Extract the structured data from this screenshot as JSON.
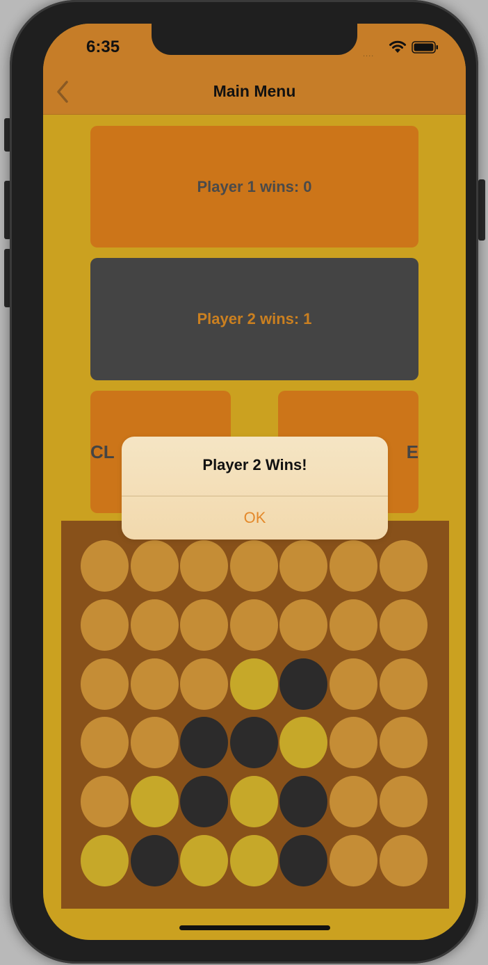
{
  "status_bar": {
    "time": "6:35",
    "signal": "....",
    "wifi_icon": "wifi-icon",
    "battery_icon": "battery-icon"
  },
  "nav": {
    "title": "Main Menu",
    "back_icon": "chevron-left-icon"
  },
  "tiles": {
    "player1": "Player 1 wins: 0",
    "player2": "Player 2 wins: 1",
    "left_fragment": "CL",
    "right_fragment": "E"
  },
  "board": {
    "colors": {
      "empty": "#c58d36",
      "yellow": "#c6a829",
      "black": "#2c2b2b"
    },
    "grid": [
      [
        "empty",
        "empty",
        "empty",
        "empty",
        "empty",
        "empty",
        "empty"
      ],
      [
        "empty",
        "empty",
        "empty",
        "empty",
        "empty",
        "empty",
        "empty"
      ],
      [
        "empty",
        "empty",
        "empty",
        "yellow",
        "black",
        "empty",
        "empty"
      ],
      [
        "empty",
        "empty",
        "black",
        "black",
        "yellow",
        "empty",
        "empty"
      ],
      [
        "empty",
        "yellow",
        "black",
        "yellow",
        "black",
        "empty",
        "empty"
      ],
      [
        "yellow",
        "black",
        "yellow",
        "yellow",
        "black",
        "empty",
        "empty"
      ]
    ]
  },
  "alert": {
    "title": "Player 2 Wins!",
    "ok": "OK"
  }
}
